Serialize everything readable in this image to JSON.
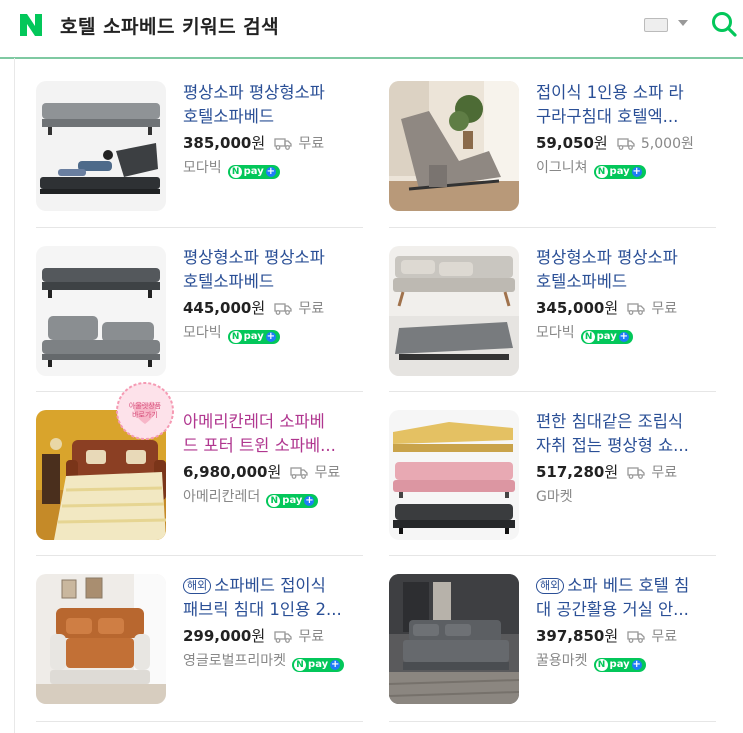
{
  "header": {
    "title": "호텔 소파베드 키워드 검색",
    "logo_letter": "N",
    "brand_color": "#03c75a",
    "keyboard_icon": "keyboard-icon",
    "search_icon": "search-icon"
  },
  "npay_label": "pay",
  "abroad_label": "해외",
  "products": [
    {
      "name_line1": "평상소파 평상형소파",
      "name_line2": "호텔소파베드",
      "price": "385,000",
      "won": "원",
      "shipping": "무료",
      "seller": "모다빅",
      "npay": true
    },
    {
      "name_line1": "접이식 1인용 소파 라",
      "name_line2": "구라구침대 호텔엑...",
      "price": "59,050",
      "won": "원",
      "shipping": "5,000원",
      "seller": "이그니쳐",
      "npay": true
    },
    {
      "name_line1": "평상형소파 평상소파",
      "name_line2": "호텔소파베드",
      "price": "445,000",
      "won": "원",
      "shipping": "무료",
      "seller": "모다빅",
      "npay": true
    },
    {
      "name_line1": "평상형소파 평상소파",
      "name_line2": "호텔소파베드",
      "price": "345,000",
      "won": "원",
      "shipping": "무료",
      "seller": "모다빅",
      "npay": true
    },
    {
      "name_line1": "아메리칸레더 소파베",
      "name_line2": "드 포터 트윈 소파베...",
      "price": "6,980,000",
      "won": "원",
      "shipping": "무료",
      "seller": "아메리칸레더",
      "npay": true,
      "sticker": "아울렛상품 바로가기"
    },
    {
      "name_line1": "편한 침대같은 조립식",
      "name_line2": "자취 접는 평상형 쇼...",
      "price": "517,280",
      "won": "원",
      "shipping": "무료",
      "seller": "G마켓",
      "npay": false
    },
    {
      "name_line1": "소파베드 접이식",
      "name_line2": "패브릭 침대 1인용 2...",
      "price": "299,000",
      "won": "원",
      "shipping": "무료",
      "seller": "영글로벌프리마켓",
      "npay": true,
      "abroad": true
    },
    {
      "name_line1": "소파 베드 호텔 침",
      "name_line2": "대 공간활용 거실 안...",
      "price": "397,850",
      "won": "원",
      "shipping": "무료",
      "seller": "꿀용마켓",
      "npay": true,
      "abroad": true
    }
  ]
}
